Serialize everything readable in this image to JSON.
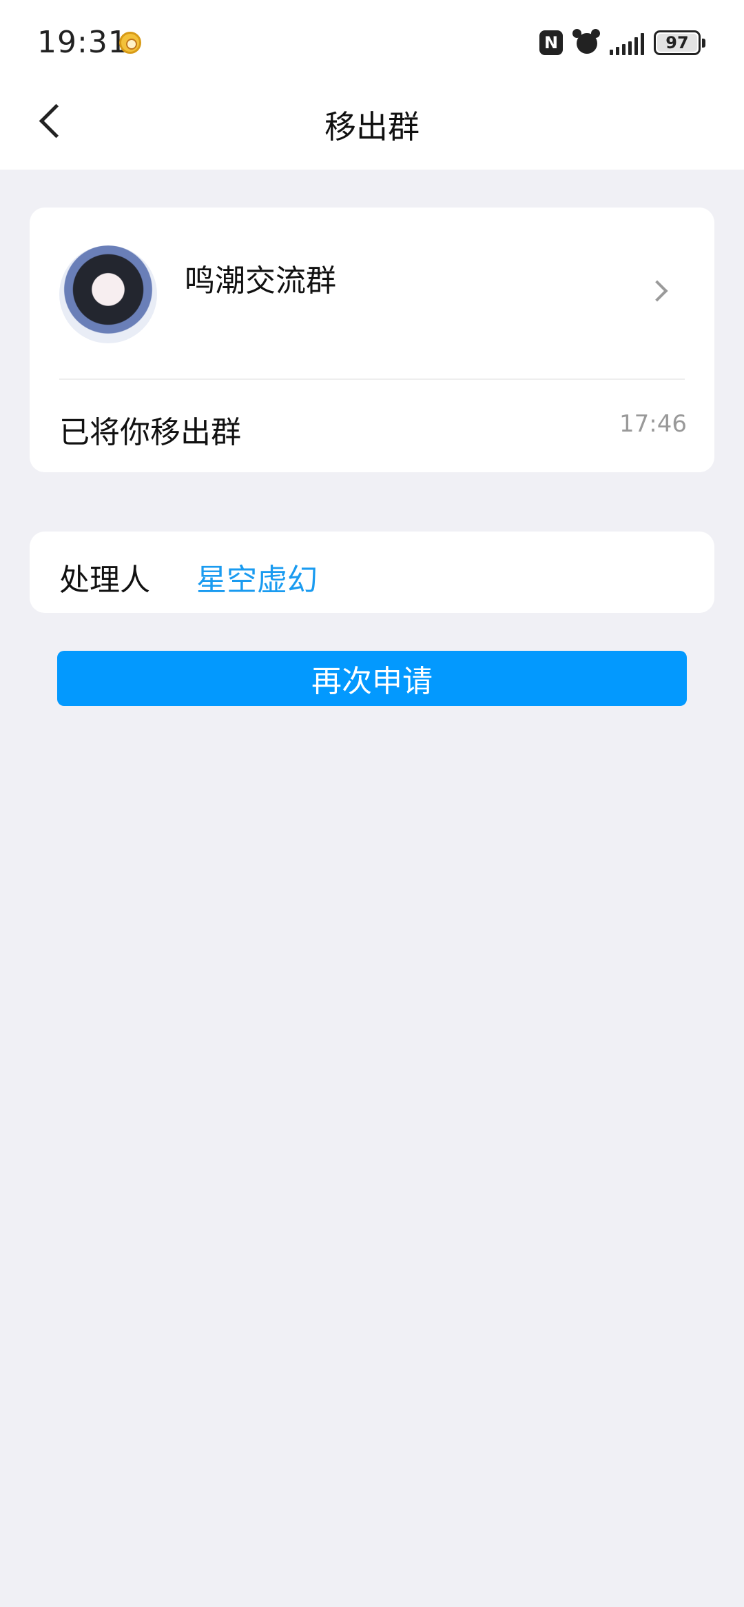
{
  "status_bar": {
    "time": "19:31",
    "battery": "97",
    "icons": [
      "app-notification-icon",
      "nfc-icon",
      "alarm-icon",
      "signal-icon",
      "battery-icon"
    ]
  },
  "nav": {
    "title": "移出群",
    "back_icon": "chevron-left-icon"
  },
  "group": {
    "name": "鸣潮交流群",
    "event": "已将你移出群",
    "time": "17:46"
  },
  "handler": {
    "label": "处理人",
    "name": "星空虚幻"
  },
  "action": {
    "button_label": "再次申请"
  },
  "colors": {
    "background": "#f0f0f5",
    "accent": "#0399fe",
    "link": "#1a9bf0"
  }
}
